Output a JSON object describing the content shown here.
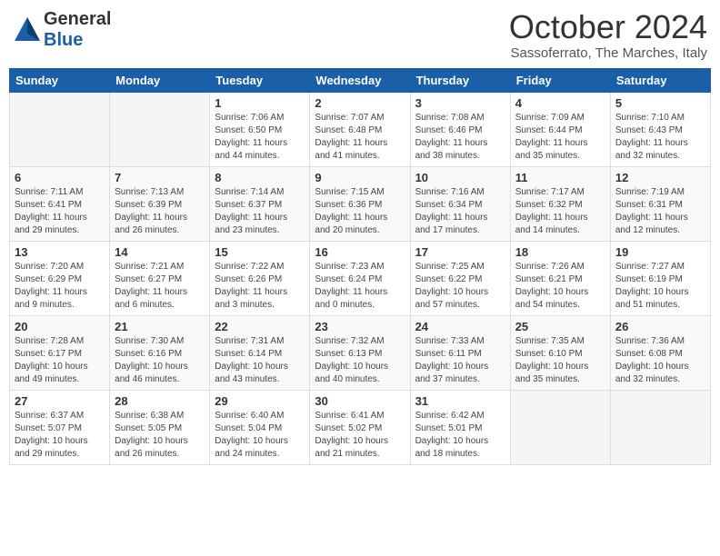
{
  "header": {
    "logo_general": "General",
    "logo_blue": "Blue",
    "month_title": "October 2024",
    "location": "Sassoferrato, The Marches, Italy"
  },
  "calendar": {
    "days_of_week": [
      "Sunday",
      "Monday",
      "Tuesday",
      "Wednesday",
      "Thursday",
      "Friday",
      "Saturday"
    ],
    "weeks": [
      [
        {
          "day": "",
          "info": ""
        },
        {
          "day": "",
          "info": ""
        },
        {
          "day": "1",
          "info": "Sunrise: 7:06 AM\nSunset: 6:50 PM\nDaylight: 11 hours and 44 minutes."
        },
        {
          "day": "2",
          "info": "Sunrise: 7:07 AM\nSunset: 6:48 PM\nDaylight: 11 hours and 41 minutes."
        },
        {
          "day": "3",
          "info": "Sunrise: 7:08 AM\nSunset: 6:46 PM\nDaylight: 11 hours and 38 minutes."
        },
        {
          "day": "4",
          "info": "Sunrise: 7:09 AM\nSunset: 6:44 PM\nDaylight: 11 hours and 35 minutes."
        },
        {
          "day": "5",
          "info": "Sunrise: 7:10 AM\nSunset: 6:43 PM\nDaylight: 11 hours and 32 minutes."
        }
      ],
      [
        {
          "day": "6",
          "info": "Sunrise: 7:11 AM\nSunset: 6:41 PM\nDaylight: 11 hours and 29 minutes."
        },
        {
          "day": "7",
          "info": "Sunrise: 7:13 AM\nSunset: 6:39 PM\nDaylight: 11 hours and 26 minutes."
        },
        {
          "day": "8",
          "info": "Sunrise: 7:14 AM\nSunset: 6:37 PM\nDaylight: 11 hours and 23 minutes."
        },
        {
          "day": "9",
          "info": "Sunrise: 7:15 AM\nSunset: 6:36 PM\nDaylight: 11 hours and 20 minutes."
        },
        {
          "day": "10",
          "info": "Sunrise: 7:16 AM\nSunset: 6:34 PM\nDaylight: 11 hours and 17 minutes."
        },
        {
          "day": "11",
          "info": "Sunrise: 7:17 AM\nSunset: 6:32 PM\nDaylight: 11 hours and 14 minutes."
        },
        {
          "day": "12",
          "info": "Sunrise: 7:19 AM\nSunset: 6:31 PM\nDaylight: 11 hours and 12 minutes."
        }
      ],
      [
        {
          "day": "13",
          "info": "Sunrise: 7:20 AM\nSunset: 6:29 PM\nDaylight: 11 hours and 9 minutes."
        },
        {
          "day": "14",
          "info": "Sunrise: 7:21 AM\nSunset: 6:27 PM\nDaylight: 11 hours and 6 minutes."
        },
        {
          "day": "15",
          "info": "Sunrise: 7:22 AM\nSunset: 6:26 PM\nDaylight: 11 hours and 3 minutes."
        },
        {
          "day": "16",
          "info": "Sunrise: 7:23 AM\nSunset: 6:24 PM\nDaylight: 11 hours and 0 minutes."
        },
        {
          "day": "17",
          "info": "Sunrise: 7:25 AM\nSunset: 6:22 PM\nDaylight: 10 hours and 57 minutes."
        },
        {
          "day": "18",
          "info": "Sunrise: 7:26 AM\nSunset: 6:21 PM\nDaylight: 10 hours and 54 minutes."
        },
        {
          "day": "19",
          "info": "Sunrise: 7:27 AM\nSunset: 6:19 PM\nDaylight: 10 hours and 51 minutes."
        }
      ],
      [
        {
          "day": "20",
          "info": "Sunrise: 7:28 AM\nSunset: 6:17 PM\nDaylight: 10 hours and 49 minutes."
        },
        {
          "day": "21",
          "info": "Sunrise: 7:30 AM\nSunset: 6:16 PM\nDaylight: 10 hours and 46 minutes."
        },
        {
          "day": "22",
          "info": "Sunrise: 7:31 AM\nSunset: 6:14 PM\nDaylight: 10 hours and 43 minutes."
        },
        {
          "day": "23",
          "info": "Sunrise: 7:32 AM\nSunset: 6:13 PM\nDaylight: 10 hours and 40 minutes."
        },
        {
          "day": "24",
          "info": "Sunrise: 7:33 AM\nSunset: 6:11 PM\nDaylight: 10 hours and 37 minutes."
        },
        {
          "day": "25",
          "info": "Sunrise: 7:35 AM\nSunset: 6:10 PM\nDaylight: 10 hours and 35 minutes."
        },
        {
          "day": "26",
          "info": "Sunrise: 7:36 AM\nSunset: 6:08 PM\nDaylight: 10 hours and 32 minutes."
        }
      ],
      [
        {
          "day": "27",
          "info": "Sunrise: 6:37 AM\nSunset: 5:07 PM\nDaylight: 10 hours and 29 minutes."
        },
        {
          "day": "28",
          "info": "Sunrise: 6:38 AM\nSunset: 5:05 PM\nDaylight: 10 hours and 26 minutes."
        },
        {
          "day": "29",
          "info": "Sunrise: 6:40 AM\nSunset: 5:04 PM\nDaylight: 10 hours and 24 minutes."
        },
        {
          "day": "30",
          "info": "Sunrise: 6:41 AM\nSunset: 5:02 PM\nDaylight: 10 hours and 21 minutes."
        },
        {
          "day": "31",
          "info": "Sunrise: 6:42 AM\nSunset: 5:01 PM\nDaylight: 10 hours and 18 minutes."
        },
        {
          "day": "",
          "info": ""
        },
        {
          "day": "",
          "info": ""
        }
      ]
    ]
  }
}
